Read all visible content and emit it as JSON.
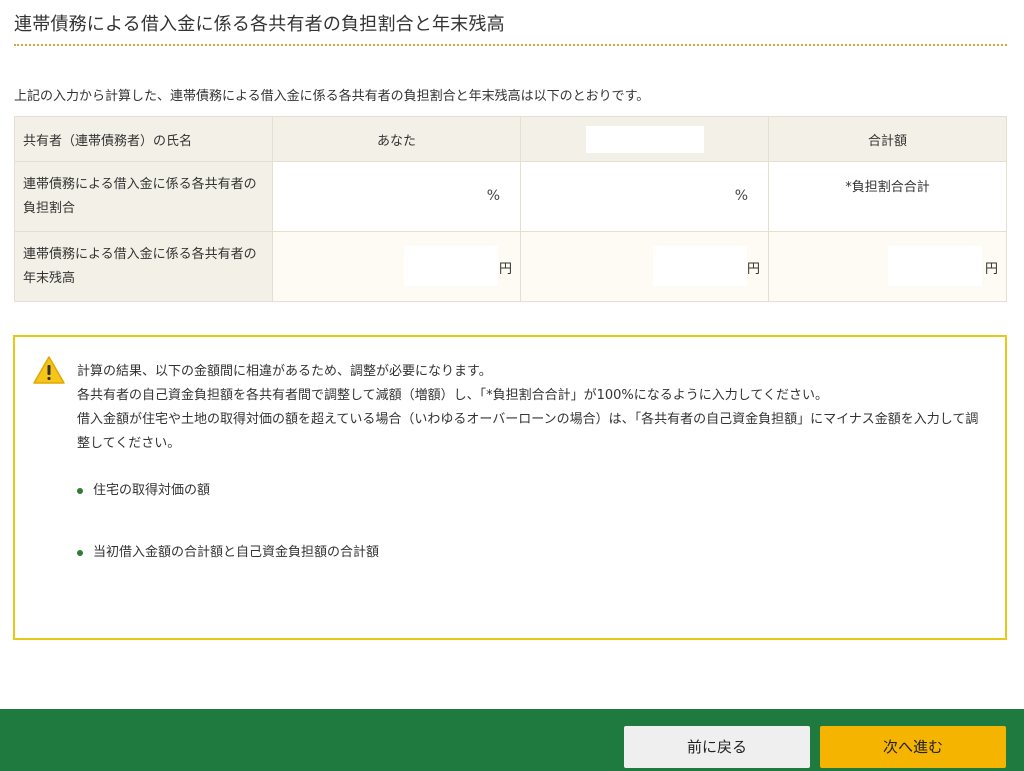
{
  "page": {
    "title": "連帯債務による借入金に係る各共有者の負担割合と年末残高",
    "intro": "上記の入力から計算した、連帯債務による借入金に係る各共有者の負担割合と年末残高は以下のとおりです。"
  },
  "table": {
    "header": {
      "owner_label": "共有者（連帯債務者）の氏名",
      "you": "あなた",
      "other": "",
      "total": "合計額"
    },
    "ratio_row": {
      "label": "連帯債務による借入金に係る各共有者の負担割合",
      "you_unit": "%",
      "other_unit": "%",
      "total_text": "*負担割合合計"
    },
    "balance_row": {
      "label": "連帯債務による借入金に係る各共有者の年末残高",
      "you_unit": "円",
      "other_unit": "円",
      "total_unit": "円"
    }
  },
  "warning": {
    "icon": "warning-triangle-icon",
    "lines": [
      "計算の結果、以下の金額間に相違があるため、調整が必要になります。",
      "各共有者の自己資金負担額を各共有者間で調整して減額（増額）し、「*負担割合合計」が100%になるように入力してください。",
      "借入金額が住宅や土地の取得対価の額を超えている場合（いわゆるオーバーローンの場合）は、「各共有者の自己資金負担額」にマイナス金額を入力して調整してください。"
    ],
    "items": [
      "住宅の取得対価の額",
      "当初借入金額の合計額と自己資金負担額の合計額"
    ]
  },
  "footer": {
    "back_label": "前に戻る",
    "next_label": "次へ進む"
  },
  "colors": {
    "accent_rule": "#d9a441",
    "footer_bg": "#1e7a3f",
    "next_button": "#f5b400",
    "warning_border": "#e6c817"
  }
}
